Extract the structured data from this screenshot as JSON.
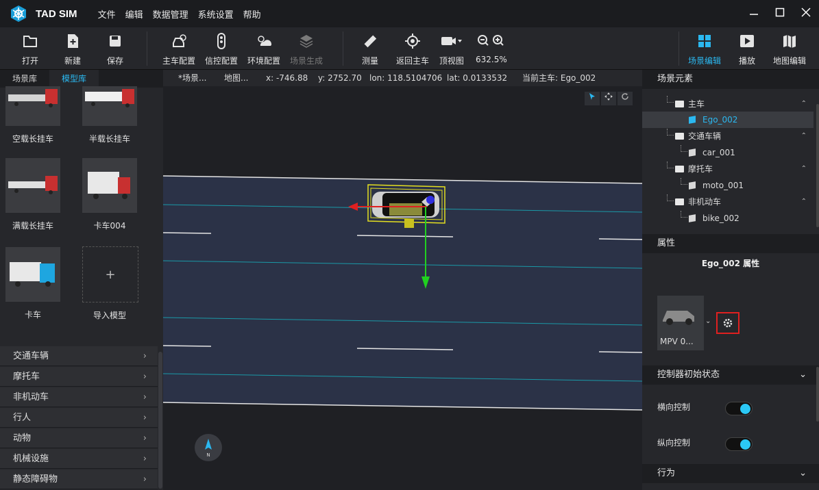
{
  "app": {
    "name": "TAD SIM",
    "menus": [
      "文件",
      "编辑",
      "数据管理",
      "系统设置",
      "帮助"
    ]
  },
  "toolbar": {
    "open": "打开",
    "new": "新建",
    "save": "保存",
    "ego_config": "主车配置",
    "signal_config": "信控配置",
    "env_config": "环境配置",
    "scene_gen": "场景生成",
    "measure": "测量",
    "back_to_ego": "返回主车",
    "top_view": "顶视图",
    "zoom": "632.5%",
    "scene_edit": "场景编辑",
    "playback": "播放",
    "map_edit": "地图编辑"
  },
  "left": {
    "tabs": [
      "场景库",
      "模型库"
    ],
    "models": [
      {
        "label": "空载长挂车"
      },
      {
        "label": "半载长挂车"
      },
      {
        "label": "满载长挂车"
      },
      {
        "label": "卡车004"
      },
      {
        "label": "卡车"
      },
      {
        "label": "导入模型",
        "icon": "+"
      }
    ],
    "categories": [
      "交通车辆",
      "摩托车",
      "非机动车",
      "行人",
      "动物",
      "机械设施",
      "静态障碍物"
    ]
  },
  "status": {
    "scene": "*场景...",
    "map": "地图...",
    "x": "x: -746.88",
    "y": "y: 2752.70",
    "lon": "lon: 118.5104706",
    "lat": "lat: 0.0133532",
    "ego": "当前主车:  Ego_002"
  },
  "compass_label": "N",
  "right": {
    "scene_elements": "场景元素",
    "tree": [
      {
        "label": "主车",
        "type": "folder"
      },
      {
        "label": "Ego_002",
        "type": "item",
        "selected": true
      },
      {
        "label": "交通车辆",
        "type": "folder"
      },
      {
        "label": "car_001",
        "type": "item"
      },
      {
        "label": "摩托车",
        "type": "folder"
      },
      {
        "label": "moto_001",
        "type": "item"
      },
      {
        "label": "非机动车",
        "type": "folder"
      },
      {
        "label": "bike_002",
        "type": "item"
      }
    ],
    "properties": "属性",
    "prop_title": "Ego_002 属性",
    "vehicle_name": "MPV 0...",
    "controller_section": "控制器初始状态",
    "lateral": "横向控制",
    "longitudinal": "纵向控制",
    "behavior": "行为"
  },
  "colors": {
    "accent": "#2bb8f0",
    "highlight_box": "#e02020",
    "road": "#2b3247"
  }
}
